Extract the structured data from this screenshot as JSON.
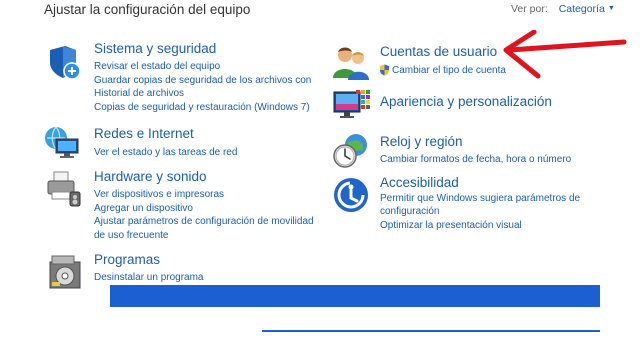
{
  "header": {
    "title": "Ajustar la configuración del equipo",
    "view_by_label": "Ver por:",
    "view_by_value": "Categoría"
  },
  "categories": {
    "system": {
      "title": "Sistema y seguridad",
      "links": [
        "Revisar el estado del equipo",
        "Guardar copias de seguridad de los archivos con",
        "Historial de archivos",
        "Copias de seguridad y restauración (Windows 7)"
      ]
    },
    "network": {
      "title": "Redes e Internet",
      "links": [
        "Ver el estado y las tareas de red"
      ]
    },
    "hardware": {
      "title": "Hardware y sonido",
      "links": [
        "Ver dispositivos e impresoras",
        "Agregar un dispositivo",
        "Ajustar parámetros de configuración de movilidad",
        "de uso frecuente"
      ]
    },
    "programs": {
      "title": "Programas",
      "links": [
        "Desinstalar un programa"
      ]
    },
    "accounts": {
      "title": "Cuentas de usuario",
      "links": [
        "Cambiar el tipo de cuenta"
      ]
    },
    "appearance": {
      "title": "Apariencia y personalización",
      "links": []
    },
    "clock": {
      "title": "Reloj y región",
      "links": [
        "Cambiar formatos de fecha, hora o número"
      ]
    },
    "ease": {
      "title": "Accesibilidad",
      "links": [
        "Permitir que Windows sugiera parámetros de",
        "configuración",
        "Optimizar la presentación visual"
      ]
    }
  },
  "colors": {
    "link": "#1c5fb0",
    "arrow": "#e0141e",
    "overlay": "#1b5fd2"
  }
}
